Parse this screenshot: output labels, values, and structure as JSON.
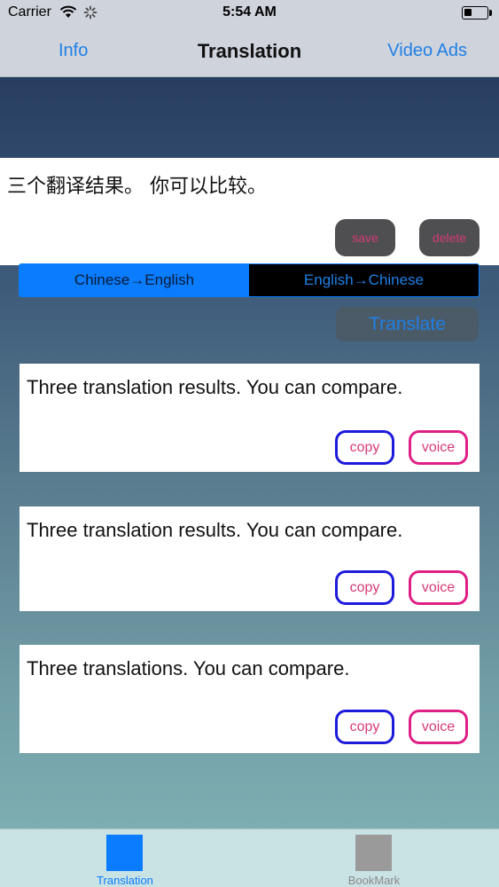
{
  "status_bar": {
    "carrier": "Carrier",
    "time": "5:54 AM",
    "battery_level": 0.35,
    "icons": [
      "wifi-icon",
      "activity-icon",
      "battery-icon"
    ]
  },
  "nav": {
    "left": "Info",
    "title": "Translation",
    "right": "Video Ads"
  },
  "input": {
    "text": "三个翻译结果。 你可以比较。",
    "save_label": "save",
    "delete_label": "delete"
  },
  "direction": {
    "options": [
      "Chinese→English",
      "English→Chinese"
    ],
    "selected": "Chinese→English"
  },
  "translate_label": "Translate",
  "results": [
    {
      "text": "Three translation results. You can compare.",
      "copy_label": "copy",
      "voice_label": "voice"
    },
    {
      "text": "Three translation results. You can compare.",
      "copy_label": "copy",
      "voice_label": "voice"
    },
    {
      "text": "Three translations. You can compare.",
      "copy_label": "copy",
      "voice_label": "voice"
    }
  ],
  "tab_bar": {
    "tabs": [
      {
        "label": "Translation",
        "selected": true
      },
      {
        "label": "BookMark",
        "selected": false
      }
    ]
  },
  "colors": {
    "accent": "#0a7cff",
    "link": "#1f7fe6",
    "button_text": "#d63a76",
    "copy_border": "#1d1adb",
    "voice_border": "#e01f86"
  }
}
